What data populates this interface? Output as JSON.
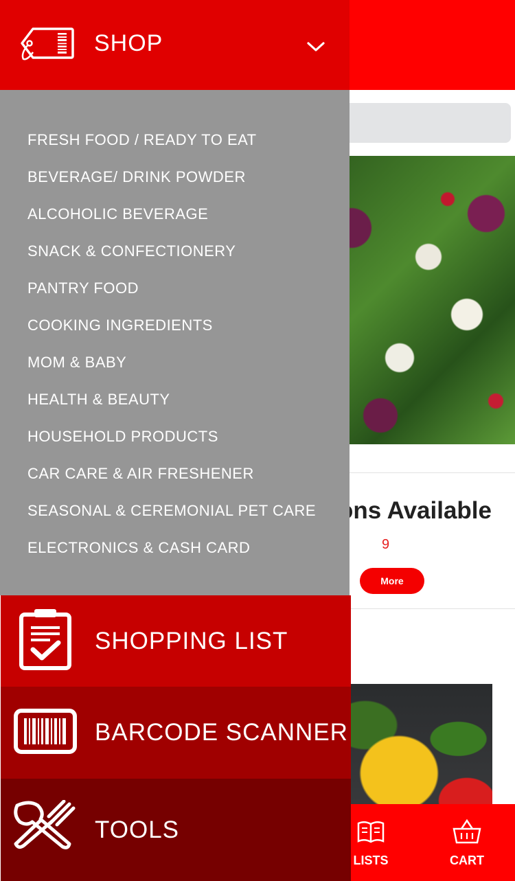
{
  "drawer": {
    "shop": {
      "label": "SHOP",
      "icon": "price-tag-icon",
      "expand_icon": "chevron-down-icon"
    },
    "categories": [
      "FRESH FOOD / READY TO EAT",
      "BEVERAGE/ DRINK POWDER",
      "ALCOHOLIC BEVERAGE",
      "SNACK & CONFECTIONERY",
      "PANTRY FOOD",
      "COOKING INGREDIENTS",
      "MOM & BABY",
      "HEALTH & BEAUTY",
      "HOUSEHOLD PRODUCTS",
      "CAR CARE & AIR FRESHENER",
      "SEASONAL & CEREMONIAL PET CARE",
      "ELECTRONICS & CASH CARD"
    ],
    "menu": [
      {
        "label": "SHOPPING LIST",
        "icon": "clipboard-check-icon"
      },
      {
        "label": "BARCODE SCANNER",
        "icon": "barcode-icon"
      },
      {
        "label": "TOOLS",
        "icon": "utensils-icon"
      }
    ]
  },
  "background": {
    "promo": {
      "heading_fragment": "ons Available",
      "count": "9",
      "more_button": "More"
    },
    "tabbar": {
      "lists_label": "LISTS",
      "cart_label": "CART"
    }
  },
  "colors": {
    "brand_red": "#ff0000",
    "shop_header": "#e00000",
    "submenu_gray": "#969696",
    "shopping_list_bg": "#c60000",
    "barcode_bg": "#a00000",
    "tools_bg": "#760000"
  }
}
